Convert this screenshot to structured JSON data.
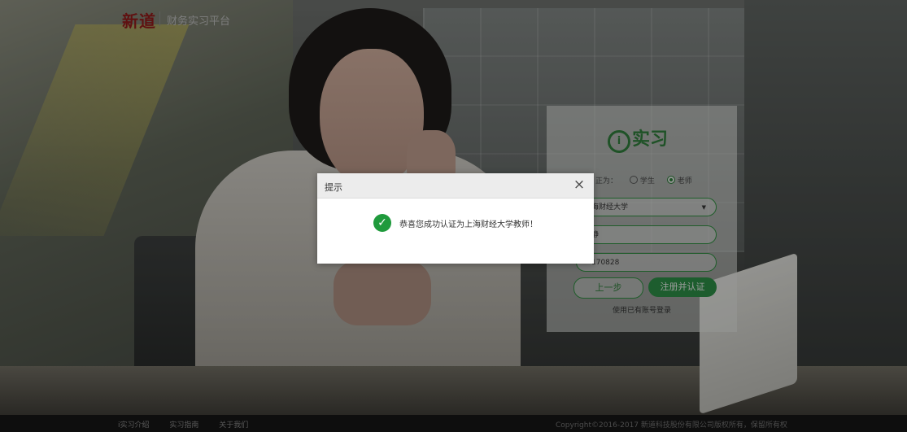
{
  "header": {
    "brand": "新道",
    "platform_name": "财务实习平台"
  },
  "register_panel": {
    "logo_text": "实习",
    "role_label": "正为：",
    "roles": [
      "学生",
      "老师"
    ],
    "selected_role": "老师",
    "school_value": "海财经大学",
    "name_value": "静",
    "phone_value": "170828",
    "prev_button": "上一步",
    "register_button": "注册并认证",
    "login_link": "使用已有账号登录"
  },
  "dialog": {
    "title": "提示",
    "close_icon": "×",
    "success_icon": "check-circle-icon",
    "message": "恭喜您成功认证为上海财经大学教师！"
  },
  "footer": {
    "links": [
      "i实习介绍",
      "实习指南",
      "关于我们"
    ],
    "copyright": "Copyright©2016-2017 新道科技股份有限公司版权所有，保留所有权"
  },
  "colors": {
    "accent_green": "#2c8a44",
    "brand_red": "#8d1a1a",
    "dialog_header": "#ececec"
  }
}
